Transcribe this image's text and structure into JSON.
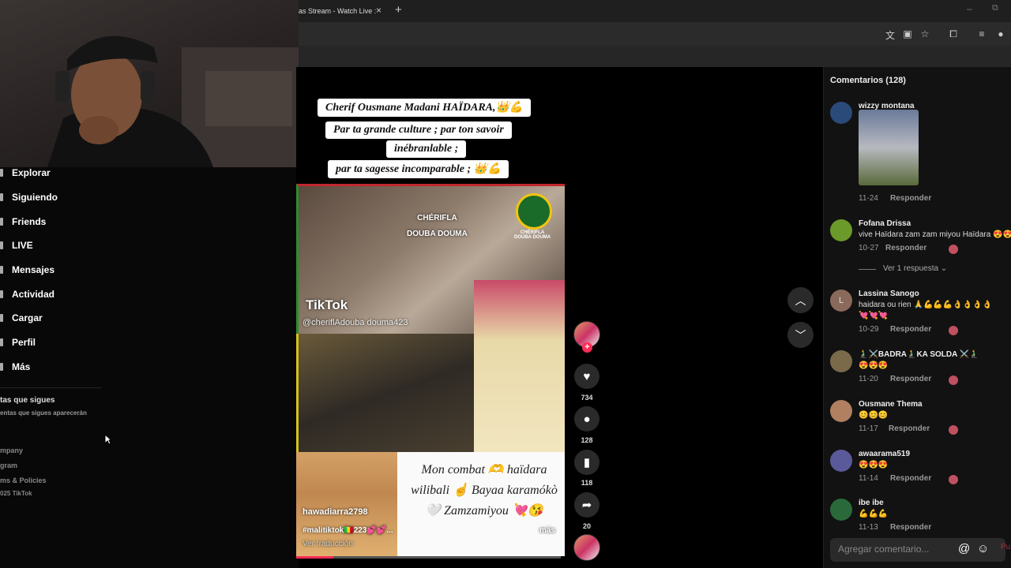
{
  "browser": {
    "tab_title": "as Stream - Watch Live :",
    "tab_close": "×",
    "new_tab": "+",
    "minimize": "–",
    "restore": "⧉",
    "toolbar_icons": [
      "translate-icon",
      "cast-icon",
      "bookmark-star-icon",
      "extensions-icon",
      "media-control-icon",
      "profile-icon"
    ]
  },
  "sidebar": {
    "items": [
      {
        "label": "Explorar"
      },
      {
        "label": "Siguiendo"
      },
      {
        "label": "Friends"
      },
      {
        "label": "LIVE"
      },
      {
        "label": "Mensajes"
      },
      {
        "label": "Actividad"
      },
      {
        "label": "Cargar"
      },
      {
        "label": "Perfil"
      },
      {
        "label": "Más"
      }
    ],
    "following_title": "tas que sigues",
    "following_sub": "entas que sigues aparecerán",
    "footer": [
      "mpany",
      "gram",
      "ms & Policies",
      "025 TikTok"
    ]
  },
  "video": {
    "captions": [
      "Cherif Ousmane Madani HAÏDARA,👑💪",
      "Par ta grande culture ; par ton savoir",
      "inébranlable ;",
      "par ta sagesse incomparable ; 👑💪"
    ],
    "watermark": "TikTok",
    "watermark_handle": "@cheriflAdouba douma423",
    "cherifla_label": "CHÉRIFLA\nDOUBA DOUMA",
    "logo_label": "CHÉRIFLA\nDOUBA DOUMA",
    "handwritten_lines": [
      "Mon combat 🫶 haïdara",
      "wilibali ☝️ Bayaa karamókò",
      "🤍 Zamzamiyou 💘😘"
    ],
    "author": "hawadiarra2798",
    "description": "#malitiktok🇲🇱223💕💕...",
    "see_translation": "Ver traducción",
    "more": "más",
    "progress": 0.14
  },
  "actions": {
    "likes": "734",
    "comments": "128",
    "saves": "118",
    "shares": "20"
  },
  "comments": {
    "title": "Comentarios (128)",
    "reply_label": "Responder",
    "view_replies": "Ver 1 respuesta",
    "input_placeholder": "Agregar comentario...",
    "post_label": "Pu",
    "items": [
      {
        "user": "wizzy montana",
        "text": "",
        "date": "11-24"
      },
      {
        "user": "Fofana Drissa",
        "text": "vive Haïdara zam zam miyou Haïdara 😍😍",
        "date": "10-27"
      },
      {
        "user": "Lassina Sanogo",
        "text": "haidara ou rien 🙏💪💪💪👌👌👌👌",
        "text2": "💘💘💘",
        "date": "10-29"
      },
      {
        "user": "🧎‍♂️⚔️BADRA🧎‍♂️KA SOLDA ⚔️🧎‍♂️",
        "text": "😍😍😍",
        "date": "11-20"
      },
      {
        "user": "Ousmane Thema",
        "text": "😊😊😊",
        "date": "11-17"
      },
      {
        "user": "awaarama519",
        "text": "😍😍😍",
        "date": "11-14"
      },
      {
        "user": "ibe ibe",
        "text": "💪💪💪",
        "date": "11-13"
      }
    ]
  }
}
